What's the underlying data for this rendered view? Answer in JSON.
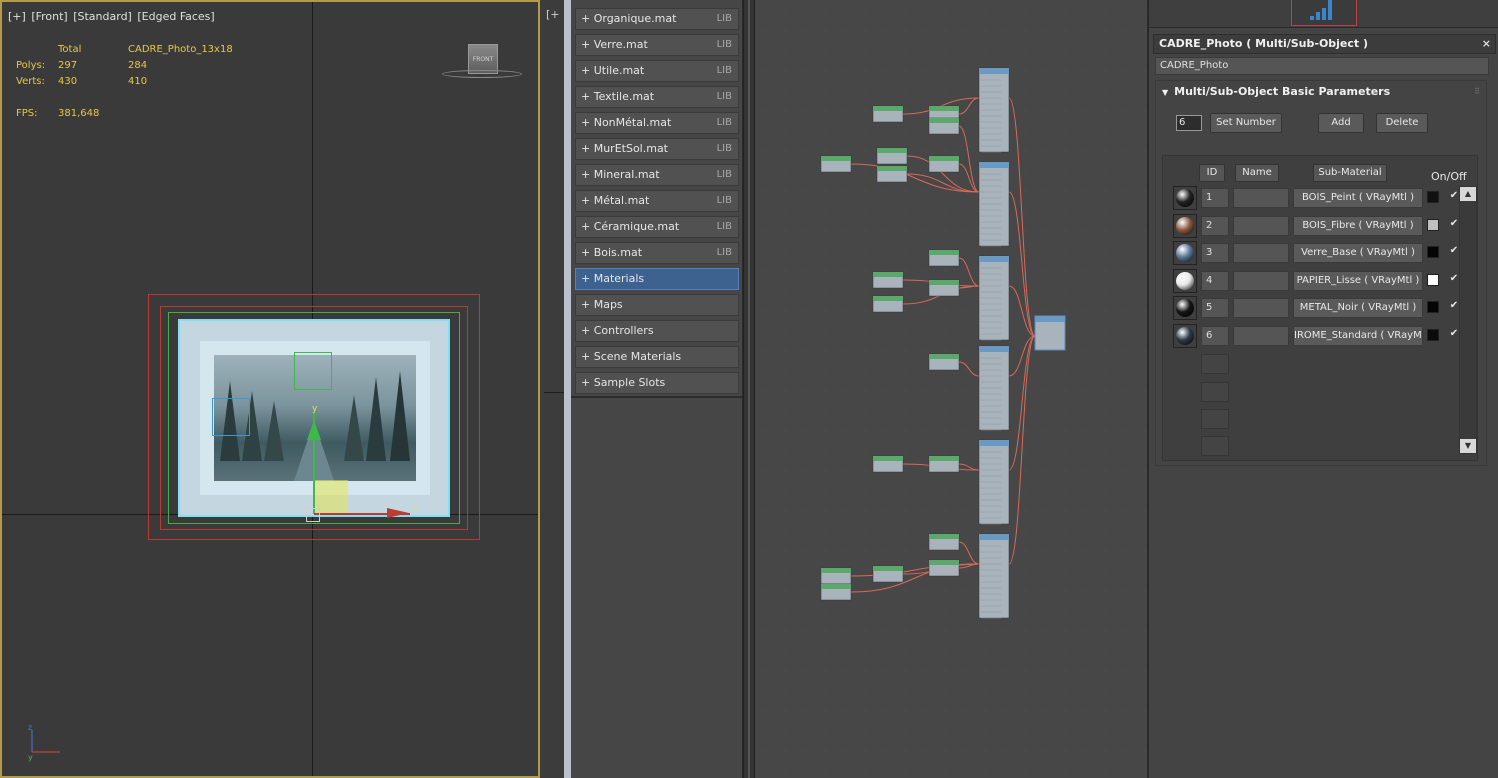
{
  "viewport": {
    "label_plus": "[+]",
    "label_view": "[Front]",
    "label_shading": "[Standard]",
    "label_edges": "[Edged Faces]",
    "stats": {
      "total_label": "Total",
      "object_name": "CADRE_Photo_13x18",
      "polys_label": "Polys:",
      "polys_total": "297",
      "polys_obj": "284",
      "verts_label": "Verts:",
      "verts_total": "430",
      "verts_obj": "410",
      "fps_label": "FPS:",
      "fps_value": "381,648"
    },
    "viewcube_label": "FRONT",
    "axis_y": "y",
    "axis_x": "x",
    "triad_z": "z",
    "triad_y": "y"
  },
  "gutter": {
    "label": "[+"
  },
  "browser": {
    "items": [
      {
        "label": "+ Organique.mat",
        "tag": "LIB"
      },
      {
        "label": "+ Verre.mat",
        "tag": "LIB"
      },
      {
        "label": "+ Utile.mat",
        "tag": "LIB"
      },
      {
        "label": "+ Textile.mat",
        "tag": "LIB"
      },
      {
        "label": "+ NonMétal.mat",
        "tag": "LIB"
      },
      {
        "label": "+ MurEtSol.mat",
        "tag": "LIB"
      },
      {
        "label": "+ Mineral.mat",
        "tag": "LIB"
      },
      {
        "label": "+ Métal.mat",
        "tag": "LIB"
      },
      {
        "label": "+ Céramique.mat",
        "tag": "LIB"
      },
      {
        "label": "+ Bois.mat",
        "tag": "LIB"
      },
      {
        "label": "+ Materials",
        "tag": ""
      },
      {
        "label": "+ Maps",
        "tag": ""
      },
      {
        "label": "+ Controllers",
        "tag": ""
      },
      {
        "label": "+ Scene Materials",
        "tag": ""
      },
      {
        "label": "+ Sample Slots",
        "tag": ""
      }
    ]
  },
  "panel": {
    "title": "CADRE_Photo  ( Multi/Sub-Object )",
    "close": "×",
    "name_value": "CADRE_Photo",
    "rollout_title": "Multi/Sub-Object Basic Parameters",
    "rollout_arrow": "▼",
    "set_number_value": "6",
    "set_number_btn": "Set Number",
    "add_btn": "Add",
    "delete_btn": "Delete",
    "col_id": "ID",
    "col_name": "Name",
    "col_sub": "Sub-Material",
    "col_onoff": "On/Off",
    "rows": [
      {
        "id": "1",
        "sub": "BOIS_Peint  ( VRayMtl )",
        "swatch": "#111111",
        "ball": "#222222",
        "check": "✔"
      },
      {
        "id": "2",
        "sub": "BOIS_Fibre  ( VRayMtl )",
        "swatch": "#c0c0c0",
        "ball": "#8a5a40",
        "check": "✔"
      },
      {
        "id": "3",
        "sub": "Verre_Base  ( VRayMtl )",
        "swatch": "#050505",
        "ball": "#5a7a9a",
        "check": "✔"
      },
      {
        "id": "4",
        "sub": "PAPIER_Lisse  ( VRayMtl )",
        "swatch": "#ffffff",
        "ball": "#e8e8e8",
        "check": "✔"
      },
      {
        "id": "5",
        "sub": "METAL_Noir  ( VRayMtl )",
        "swatch": "#050505",
        "ball": "#151515",
        "check": "✔"
      },
      {
        "id": "6",
        "sub": "IROME_Standard  ( VRayMtl",
        "swatch": "#0a0a0a",
        "ball": "#2a3a4a",
        "check": "✔"
      }
    ],
    "scroll_up": "▲",
    "scroll_down": "▼"
  },
  "colors": {
    "viewport_border": "#b59a4b",
    "stats_text": "#e6c84a",
    "active_item": "#3e6290",
    "wire": "#d86a5a",
    "node_header": "#6a9ac4",
    "node_green": "#5aa86a"
  }
}
